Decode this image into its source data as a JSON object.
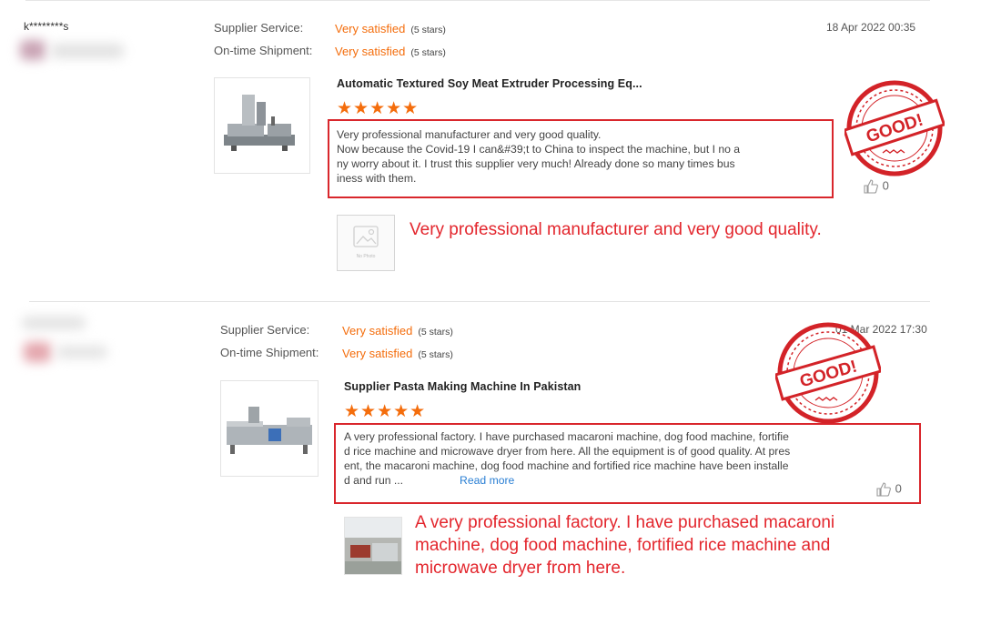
{
  "reviews": [
    {
      "username": "k********s",
      "service_label": "Supplier Service:",
      "service_value": "Very satisfied",
      "service_stars": "(5 stars)",
      "shipment_label": "On-time Shipment:",
      "shipment_value": "Very satisfied",
      "shipment_stars": "(5 stars)",
      "date": "18 Apr 2022 00:35",
      "product_title": "Automatic Textured Soy Meat Extruder Processing Eq...",
      "rating": "★★★★★",
      "review_lines": [
        "Very professional manufacturer and very good quality.",
        "Now because the Covid-19 I can&#39;t to China to inspect the machine, but I no a",
        "ny worry about it.  I trust this supplier very much! Already done so many times bus",
        "iness with them."
      ],
      "likes": "0",
      "photo_placeholder": "No Photo",
      "stamp_text": "GOOD!",
      "annotation": "Very professional manufacturer and very good quality."
    },
    {
      "username": "",
      "service_label": "Supplier Service:",
      "service_value": "Very satisfied",
      "service_stars": "(5 stars)",
      "shipment_label": "On-time Shipment:",
      "shipment_value": "Very satisfied",
      "shipment_stars": "(5 stars)",
      "date": "01 Mar 2022 17:30",
      "product_title": "Supplier Pasta Making Machine In Pakistan",
      "rating": "★★★★★",
      "review_lines": [
        "A very professional factory. I have purchased macaroni machine, dog food machine, fortifie",
        "d rice machine and microwave dryer from here. All the equipment is of good quality. At pres",
        "ent, the macaroni machine, dog food machine and fortified rice machine have been installe",
        "d and run ..."
      ],
      "read_more": "Read more",
      "likes": "0",
      "stamp_text": "GOOD!",
      "annotation_lines": [
        "A very professional factory. I have purchased macaroni",
        "machine, dog food machine, fortified rice machine and",
        "microwave dryer from here."
      ]
    }
  ],
  "colors": {
    "accent": "#f46d0c",
    "annotation_red": "#e3262d",
    "link": "#2a7fd4"
  },
  "icons": [
    "thumbs-up-icon",
    "no-photo-icon"
  ]
}
